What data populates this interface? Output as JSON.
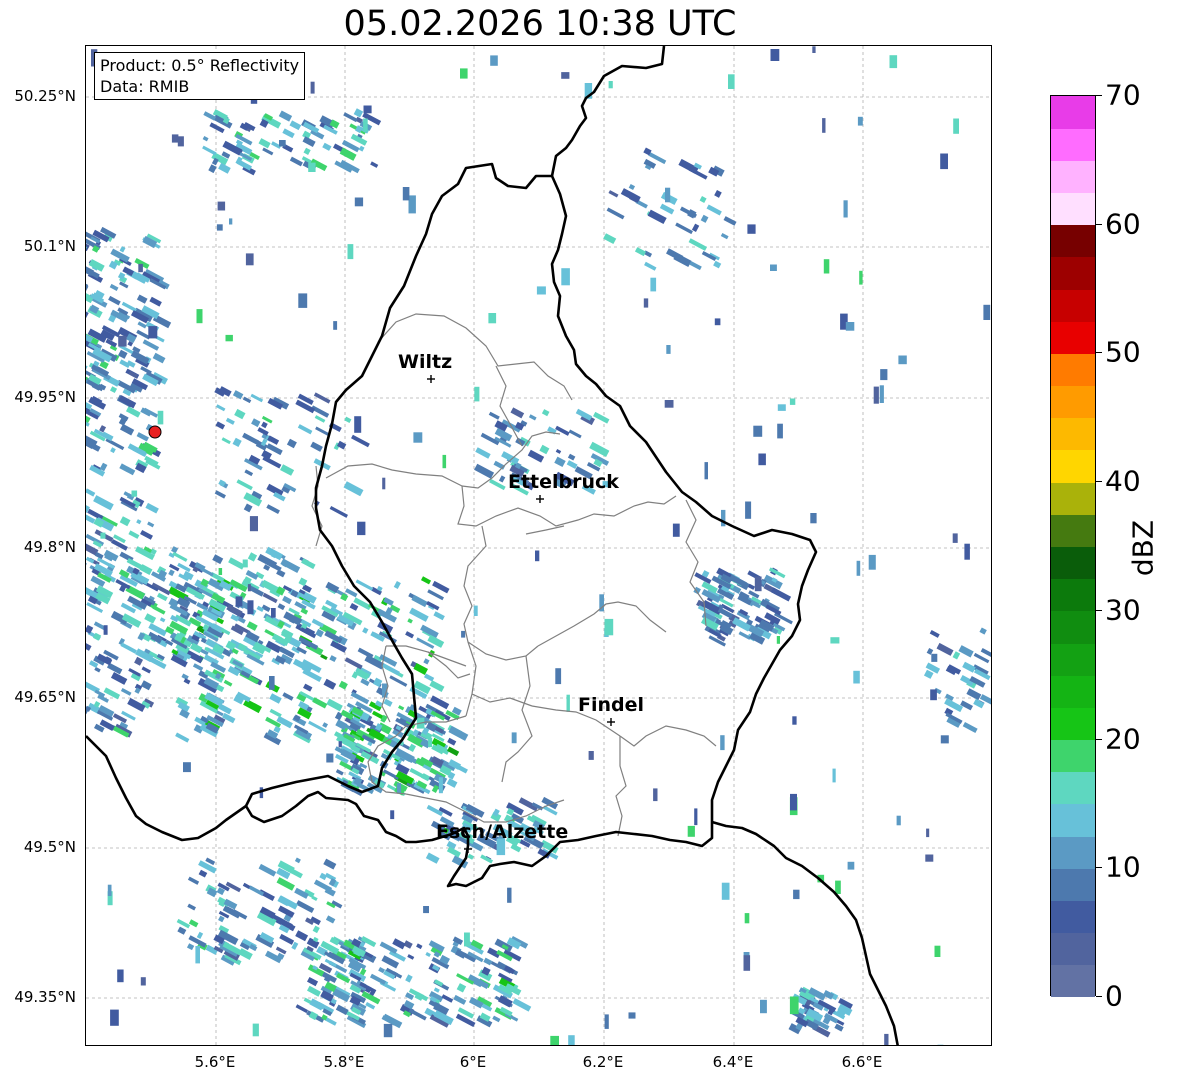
{
  "title": "05.02.2026 10:38 UTC",
  "info": {
    "product": "Product: 0.5° Reflectivity",
    "data": "Data: RMIB"
  },
  "latitude_labels": [
    "50.25°N",
    "50.1°N",
    "49.95°N",
    "49.8°N",
    "49.65°N",
    "49.5°N",
    "49.35°N"
  ],
  "longitude_labels": [
    "5.6°E",
    "5.8°E",
    "6°E",
    "6.2°E",
    "6.4°E",
    "6.6°E"
  ],
  "towns": [
    {
      "name": "Wiltz"
    },
    {
      "name": "Ettelbruck"
    },
    {
      "name": "Findel"
    },
    {
      "name": "Esch/Alzette"
    }
  ],
  "colorbar": {
    "unit": "dBZ",
    "tick_labels": [
      "0",
      "10",
      "20",
      "30",
      "40",
      "50",
      "60",
      "70"
    ],
    "min": 0,
    "max": 70,
    "step": 2.5,
    "colors": [
      "#6272a4",
      "#51649e",
      "#415ba0",
      "#4d79ae",
      "#5b9ac4",
      "#67c1d9",
      "#5ed7c0",
      "#3ed46c",
      "#16c516",
      "#14b414",
      "#13a113",
      "#108d10",
      "#0c7a0c",
      "#0a5d0a",
      "#457a10",
      "#aab20a",
      "#ffd600",
      "#fdb900",
      "#ff9b00",
      "#ff7b00",
      "#e80000",
      "#c70000",
      "#9d0000",
      "#770000",
      "#ffdfff",
      "#ffb2ff",
      "#ff6cff",
      "#e83ce8"
    ]
  },
  "accent_colors": {
    "country_border": "#000000",
    "canton_border": "#808080",
    "radar_site": "#e82020",
    "grid": "#b0b0b0"
  }
}
